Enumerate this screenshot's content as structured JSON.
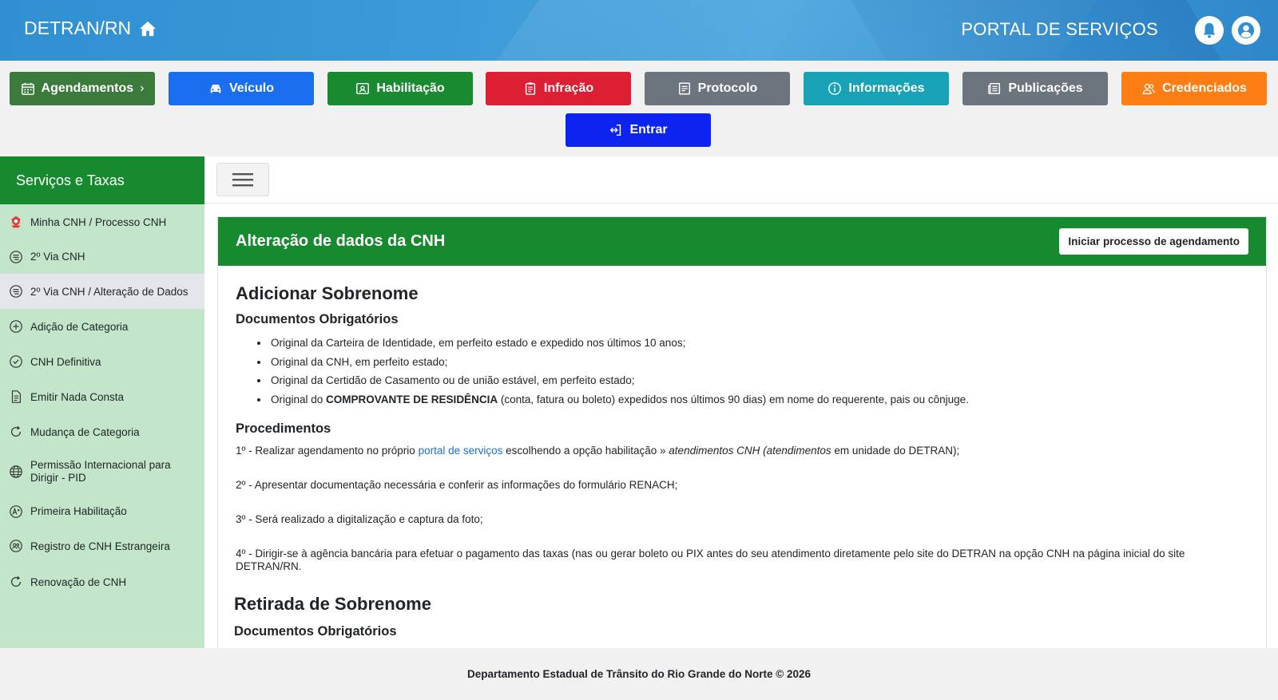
{
  "header": {
    "brand": "DETRAN/RN",
    "portal_title": "PORTAL DE SERVIÇOS"
  },
  "nav": {
    "buttons": [
      {
        "label": "Agendamentos",
        "color": "#3b7a3b",
        "icon": "calendar-icon"
      },
      {
        "label": "Veículo",
        "color": "#1a6ff0",
        "icon": "car-icon"
      },
      {
        "label": "Habilitação",
        "color": "#198a30",
        "icon": "id-card-icon"
      },
      {
        "label": "Infração",
        "color": "#dc1f33",
        "icon": "clipboard-icon"
      },
      {
        "label": "Protocolo",
        "color": "#6c757d",
        "icon": "document-icon"
      },
      {
        "label": "Informações",
        "color": "#17a2b8",
        "icon": "info-icon"
      },
      {
        "label": "Publicações",
        "color": "#6c757d",
        "icon": "newspaper-icon"
      },
      {
        "label": "Credenciados",
        "color": "#fd7e14",
        "icon": "users-icon"
      }
    ],
    "enter_label": "Entrar",
    "enter_color": "#0d23f0"
  },
  "sidebar": {
    "title": "Serviços e Taxas",
    "items": [
      {
        "label": "Minha CNH / Processo CNH",
        "icon": "cnh-hat-icon"
      },
      {
        "label": "2º Via CNH",
        "icon": "list-circle-icon"
      },
      {
        "label": "2º Via CNH / Alteração de Dados",
        "icon": "list-circle-icon",
        "active": true
      },
      {
        "label": "Adição de Categoria",
        "icon": "plus-circle-icon"
      },
      {
        "label": "CNH Definitiva",
        "icon": "check-circle-icon"
      },
      {
        "label": "Emitir Nada Consta",
        "icon": "file-text-icon"
      },
      {
        "label": "Mudança de Categoria",
        "icon": "refresh-icon"
      },
      {
        "label": "Permissão Internacional para Dirigir - PID",
        "icon": "globe-icon"
      },
      {
        "label": "Primeira Habilitação",
        "icon": "a-plus-icon"
      },
      {
        "label": "Registro de CNH Estrangeira",
        "icon": "users-circle-icon"
      },
      {
        "label": "Renovação de CNH",
        "icon": "refresh-icon"
      }
    ]
  },
  "card": {
    "title": "Alteração de dados da CNH",
    "action_label": "Iniciar processo de agendamento",
    "section1": {
      "title": "Adicionar Sobrenome",
      "docs_title": "Documentos Obrigatórios",
      "docs": [
        "Original da Carteira de Identidade, em perfeito estado e expedido nos últimos 10 anos;",
        "Original da CNH, em perfeito estado;",
        "Original da Certidão de Casamento ou de união estável, em perfeito estado;"
      ],
      "doc4_pre": "Original do ",
      "doc4_bold": "COMPROVANTE DE RESIDÊNCIA",
      "doc4_post": " (conta, fatura ou boleto) expedidos nos últimos 90 dias) em nome do requerente, pais ou cônjuge.",
      "proc_title": "Procedimentos",
      "proc1_pre": "1º - Realizar agendamento no próprio ",
      "proc1_link": "portal de serviços",
      "proc1_mid": " escolhendo a opção habilitação » ",
      "proc1_italic1": "atendimentos CNH (atendimentos",
      "proc1_post": " em unidade do DETRAN);",
      "proc2": "2º - Apresentar documentação necessária e conferir as informações do formulário RENACH;",
      "proc3": "3º - Será realizado a digitalização e captura da foto;",
      "proc4": "4º - Dirigir-se à agência bancária para efetuar o pagamento das taxas (nas ou gerar boleto ou PIX antes do seu atendimento diretamente pelo site do DETRAN na opção CNH na página inicial do site DETRAN/RN."
    },
    "section2": {
      "title": "Retirada de Sobrenome",
      "docs_title": "Documentos Obrigatórios"
    }
  },
  "footer": {
    "text": "Departamento Estadual de Trânsito do Rio Grande do Norte © 2026"
  }
}
